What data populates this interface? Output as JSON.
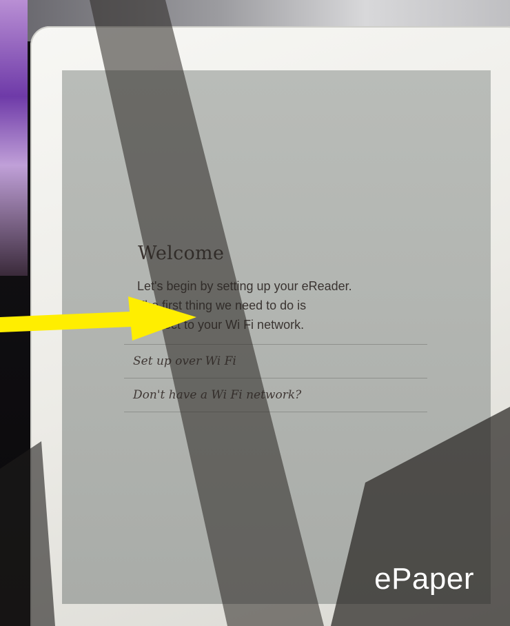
{
  "screen": {
    "title": "Welcome",
    "intro_lines": [
      "Let's begin by setting up your eReader.",
      "The first thing we need to do is",
      "connect to your Wi Fi network."
    ],
    "options": [
      {
        "label": "Set up over Wi Fi"
      },
      {
        "label": "Don't have a Wi Fi network?"
      }
    ]
  },
  "annotation": {
    "caption": "ePaper",
    "arrow_color": "#ffee00"
  },
  "colors": {
    "screen_bg": "#b4b7b3",
    "frame": "#efefeb",
    "text": "#3b3431"
  }
}
